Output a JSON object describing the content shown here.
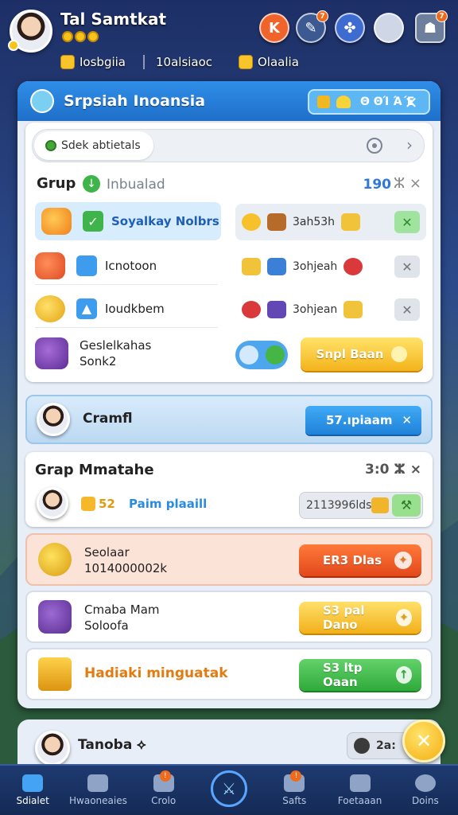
{
  "player": {
    "name": "Tal Samtkat",
    "stats": [
      "Iosbgiia",
      "10alsiaoc",
      "Olaalia"
    ]
  },
  "header_badges": {
    "hb2": "7",
    "hb5": "7"
  },
  "panel": {
    "title": "Srpsiah Inoansia",
    "pill_text": "Θ ΘΊ Ά΄Ε",
    "search_chip": "Sdek abtietals",
    "group": {
      "label": "Grup",
      "sub": "Inbualad",
      "count": "190",
      "tools": "ⵣ ×"
    },
    "left_rows": [
      {
        "label": "Soyalkay Nolbrs"
      },
      {
        "label": "Icnotoon"
      },
      {
        "label": "Ioudkbem"
      },
      {
        "label": "Geslelkahas\nSonk2"
      }
    ],
    "right_rows": [
      {
        "label": "3ah53h"
      },
      {
        "label": "3ohjeah"
      },
      {
        "label": "3ohjean"
      }
    ],
    "main_button": "Snpl Baan",
    "crew": {
      "name": "Cramfl",
      "button": "57.ıpiaam"
    },
    "group_match": {
      "title": "Grap Mmatahe",
      "meta": "3:0 ⵣ ×",
      "rank": "52",
      "sub": "Paim plaaill",
      "pill_text": "2113996lds"
    },
    "rewards": [
      {
        "label": "Seolaar\n1014000002k",
        "button": "ER3 Dlas"
      },
      {
        "label": "Cmaba Mam\nSoloofa",
        "button": "S3 pal Dano"
      },
      {
        "label": "Hadiaki minguatak",
        "button": "S3 ltp Oaan"
      }
    ]
  },
  "peek": {
    "name": "Tanoba ⟡",
    "pill": "2a:"
  },
  "nav": [
    {
      "label": "Sdialet"
    },
    {
      "label": "Hwaoneaies"
    },
    {
      "label": "Crolo"
    },
    {
      "label": ""
    },
    {
      "label": "Safts"
    },
    {
      "label": "Foetaaan"
    },
    {
      "label": "Doins"
    }
  ],
  "colors": {
    "accent": "#1f82d9",
    "orange": "#e3481b",
    "yellow": "#f4b31b",
    "green": "#2faa3a"
  }
}
